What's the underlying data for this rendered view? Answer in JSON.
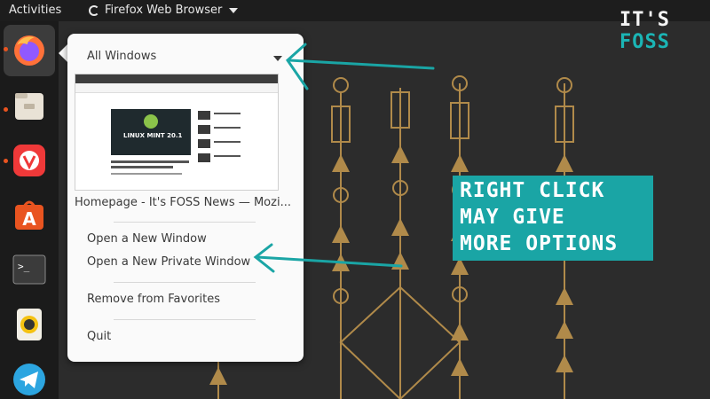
{
  "topbar": {
    "activities": "Activities",
    "app_name": "Firefox Web Browser"
  },
  "dock": {
    "items": [
      {
        "name": "firefox-icon",
        "running": true
      },
      {
        "name": "files-icon",
        "running": true
      },
      {
        "name": "vivaldi-icon",
        "running": true
      },
      {
        "name": "software-center-icon",
        "running": false
      },
      {
        "name": "terminal-icon",
        "running": false
      },
      {
        "name": "rhythmbox-icon",
        "running": false
      },
      {
        "name": "telegram-icon",
        "running": false
      }
    ],
    "terminal_prompt": ">_"
  },
  "logo": {
    "part1": "IT'S",
    "part2": "FOSS"
  },
  "menu": {
    "all_windows": "All Windows",
    "thumbnail_title": "Homepage - It's FOSS News — Mozi...",
    "thumbnail_hero_text": "LINUX MINT 20.1",
    "open_new_window": "Open a New Window",
    "open_private_window": "Open a New Private Window",
    "remove_favorites": "Remove from Favorites",
    "quit": "Quit"
  },
  "callout": {
    "line1": "RIGHT CLICK",
    "line2": "MAY GIVE",
    "line3": "MORE OPTIONS"
  },
  "colors": {
    "accent_teal": "#1aa5a5",
    "wallpaper_gold": "#b08a4a",
    "ubuntu_orange": "#e95420"
  }
}
